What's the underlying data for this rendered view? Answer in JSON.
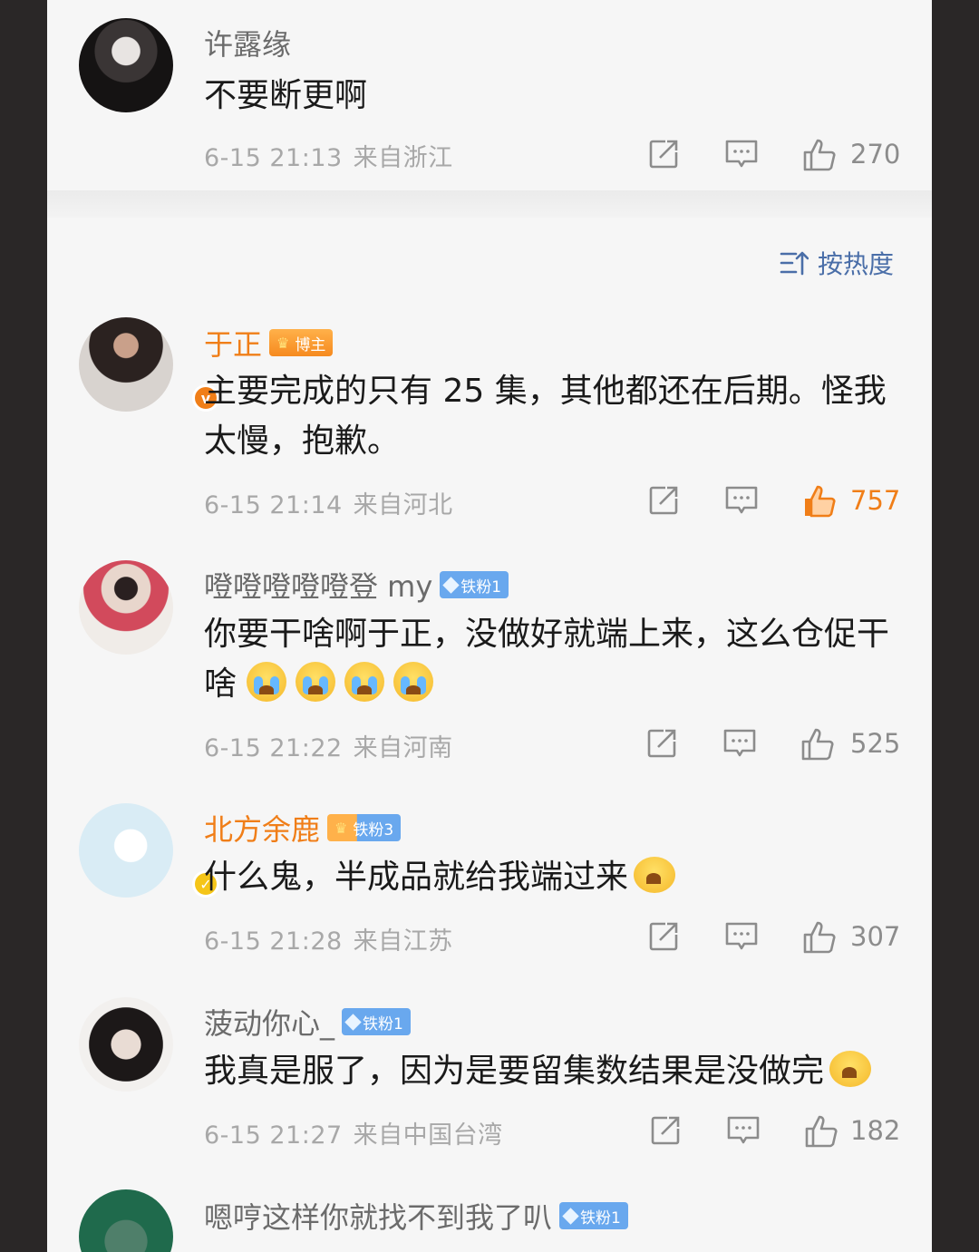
{
  "sort": {
    "label": "按热度"
  },
  "comments": [
    {
      "name": "许露缘",
      "text": "不要断更啊",
      "time": "6-15 21:13",
      "location": "来自浙江",
      "likes": "270"
    },
    {
      "name": "于正",
      "badge": "博主",
      "text": "主要完成的只有 25 集，其他都还在后期。怪我太慢，抱歉。",
      "time": "6-15 21:14",
      "location": "来自河北",
      "likes": "757"
    },
    {
      "name": "噔噔噔噔噔登 my",
      "badge": "铁粉1",
      "text": "你要干啥啊于正，没做好就端上来，这么仓促干啥",
      "time": "6-15 21:22",
      "location": "来自河南",
      "likes": "525"
    },
    {
      "name": "北方余鹿",
      "badge": "铁粉3",
      "text": "什么鬼，半成品就给我端过来",
      "time": "6-15 21:28",
      "location": "来自江苏",
      "likes": "307"
    },
    {
      "name": "菠动你心_",
      "badge": "铁粉1",
      "text": "我真是服了，因为是要留集数结果是没做完",
      "time": "6-15 21:27",
      "location": "来自中国台湾",
      "likes": "182"
    },
    {
      "name": "嗯哼这样你就找不到我了叭",
      "badge": "铁粉1"
    }
  ],
  "colors": {
    "vip_name": "#f07e18",
    "fan_badge": "#69a8ee",
    "sort_link": "#4a6ea8",
    "liked": "#f07e18"
  }
}
